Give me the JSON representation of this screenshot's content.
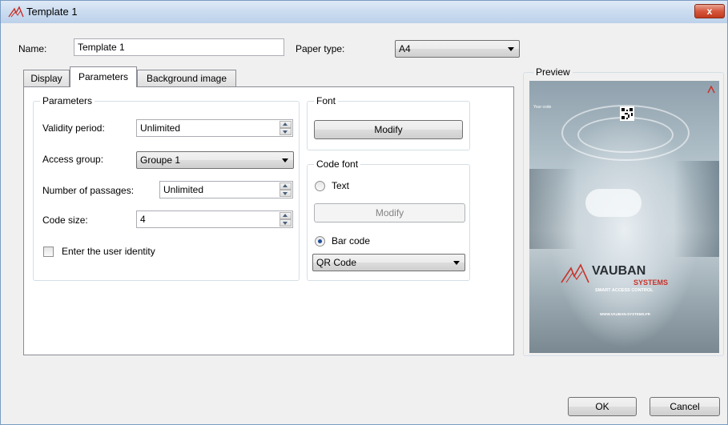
{
  "window": {
    "title": "Template 1",
    "close_glyph": "x"
  },
  "form": {
    "name_label": "Name:",
    "name_value": "Template 1",
    "paper_type_label": "Paper type:",
    "paper_type_value": "A4"
  },
  "tabs": [
    {
      "label": "Display",
      "active": false
    },
    {
      "label": "Parameters",
      "active": true
    },
    {
      "label": "Background image",
      "active": false
    }
  ],
  "parameters": {
    "group_title": "Parameters",
    "validity_label": "Validity period:",
    "validity_value": "Unlimited",
    "access_group_label": "Access group:",
    "access_group_value": "Groupe 1",
    "passages_label": "Number of passages:",
    "passages_value": "Unlimited",
    "code_size_label": "Code size:",
    "code_size_value": "4",
    "user_identity_label": "Enter the user identity",
    "user_identity_checked": false
  },
  "font": {
    "group_title": "Font",
    "modify_label": "Modify"
  },
  "code_font": {
    "group_title": "Code font",
    "text_option_label": "Text",
    "text_modify_label": "Modify",
    "bar_code_option_label": "Bar code",
    "selected_option": "Bar code",
    "bar_code_type_value": "QR Code"
  },
  "preview": {
    "title": "Preview",
    "small_corner_text": "Your code",
    "logo_main": "VAUBAN",
    "logo_systems": "SYSTEMS",
    "logo_tagline": "SMART ACCESS CONTROL",
    "logo_url": "WWW.VAUBAN-SYSTEMS.FR"
  },
  "footer": {
    "ok_label": "OK",
    "cancel_label": "Cancel"
  },
  "colors": {
    "accent_red": "#c8322a",
    "title_bar": "#cbdcf0"
  }
}
